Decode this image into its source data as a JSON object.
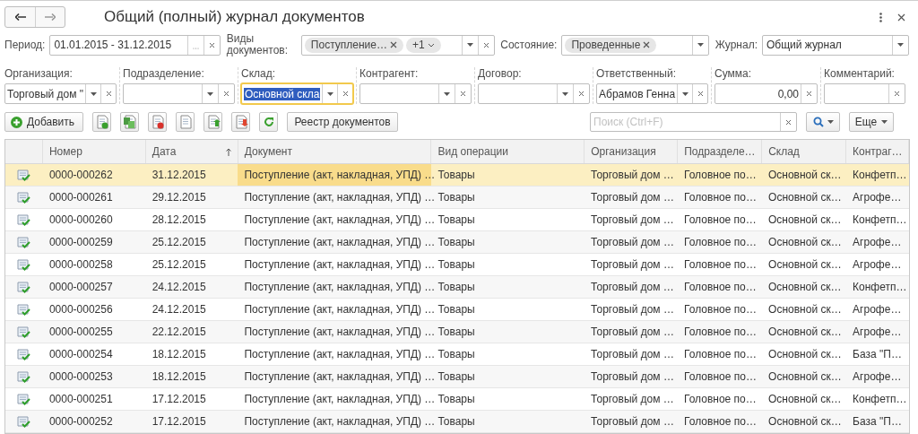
{
  "title": "Общий (полный) журнал документов",
  "filters": [
    {
      "kind": "period",
      "label": "Период:",
      "value": "01.01.2015 - 31.12.2015"
    },
    {
      "kind": "tags",
      "label": "Виды документов:",
      "tags": [
        "Поступление…"
      ],
      "more": "+1"
    },
    {
      "kind": "tags",
      "label": "Состояние:",
      "tags": [
        "Проведенные"
      ]
    },
    {
      "kind": "select",
      "label": "Журнал:",
      "value": "Общий журнал"
    }
  ],
  "fields": [
    {
      "kind": "select",
      "label": "Организация:",
      "value": "Торговый дом \"",
      "focused": false
    },
    {
      "kind": "select",
      "label": "Подразделение:",
      "focused": false
    },
    {
      "kind": "select",
      "label": "Склад:",
      "value": "Основной скла",
      "focused": true
    },
    {
      "kind": "select",
      "label": "Контрагент:",
      "focused": false
    },
    {
      "kind": "select",
      "label": "Договор:",
      "focused": false
    },
    {
      "kind": "select",
      "label": "Ответственный:",
      "value": "Абрамов Генна",
      "focused": false
    },
    {
      "kind": "number",
      "label": "Сумма:",
      "value": "0,00",
      "focused": false
    },
    {
      "kind": "text",
      "label": "Комментарий:",
      "focused": false
    }
  ],
  "toolbar": {
    "add": "Добавить",
    "registry": "Реестр документов",
    "search_placeholder": "Поиск (Ctrl+F)",
    "more": "Еще"
  },
  "columns": [
    {
      "label": "Номер",
      "sorted": false
    },
    {
      "label": "Дата",
      "sorted": true
    },
    {
      "label": "Документ",
      "sorted": false
    },
    {
      "label": "Вид операции",
      "sorted": false
    },
    {
      "label": "Организация",
      "sorted": false
    },
    {
      "label": "Подразделе…",
      "sorted": false
    },
    {
      "label": "Склад",
      "sorted": false
    },
    {
      "label": "Контраг…",
      "sorted": false
    }
  ],
  "rows": [
    {
      "selected": true,
      "cells": [
        "0000-000262",
        "31.12.2015",
        "Поступление (акт, накладная, УПД) …",
        "Товары",
        "Торговый дом …",
        "Головное по…",
        "Основной ск…",
        "Конфетп…"
      ]
    },
    {
      "selected": false,
      "cells": [
        "0000-000261",
        "29.12.2015",
        "Поступление (акт, накладная, УПД) …",
        "Товары",
        "Торговый дом …",
        "Головное по…",
        "Основной ск…",
        "Агрофе…"
      ]
    },
    {
      "selected": false,
      "cells": [
        "0000-000260",
        "28.12.2015",
        "Поступление (акт, накладная, УПД) …",
        "Товары",
        "Торговый дом …",
        "Головное по…",
        "Основной ск…",
        "Конфетп…"
      ]
    },
    {
      "selected": false,
      "cells": [
        "0000-000259",
        "25.12.2015",
        "Поступление (акт, накладная, УПД) …",
        "Товары",
        "Торговый дом …",
        "Головное по…",
        "Основной ск…",
        "Агрофе…"
      ]
    },
    {
      "selected": false,
      "cells": [
        "0000-000258",
        "25.12.2015",
        "Поступление (акт, накладная, УПД) …",
        "Товары",
        "Торговый дом …",
        "Головное по…",
        "Основной ск…",
        "Агрофе…"
      ]
    },
    {
      "selected": false,
      "cells": [
        "0000-000257",
        "24.12.2015",
        "Поступление (акт, накладная, УПД) …",
        "Товары",
        "Торговый дом …",
        "Головное по…",
        "Основной ск…",
        "Конфетп…"
      ]
    },
    {
      "selected": false,
      "cells": [
        "0000-000256",
        "24.12.2015",
        "Поступление (акт, накладная, УПД) …",
        "Товары",
        "Торговый дом …",
        "Головное по…",
        "Основной ск…",
        "Агрофе…"
      ]
    },
    {
      "selected": false,
      "cells": [
        "0000-000255",
        "22.12.2015",
        "Поступление (акт, накладная, УПД) …",
        "Товары",
        "Торговый дом …",
        "Головное по…",
        "Основной ск…",
        "Агрофе…"
      ]
    },
    {
      "selected": false,
      "cells": [
        "0000-000254",
        "18.12.2015",
        "Поступление (акт, накладная, УПД) …",
        "Товары",
        "Торговый дом …",
        "Головное по…",
        "Основной ск…",
        "База \"П…"
      ]
    },
    {
      "selected": false,
      "cells": [
        "0000-000253",
        "18.12.2015",
        "Поступление (акт, накладная, УПД) …",
        "Товары",
        "Торговый дом …",
        "Головное по…",
        "Основной ск…",
        "Агрофе…"
      ]
    },
    {
      "selected": false,
      "cells": [
        "0000-000251",
        "17.12.2015",
        "Поступление (акт, накладная, УПД) …",
        "Товары",
        "Торговый дом …",
        "Головное по…",
        "Основной ск…",
        "Конфетп…"
      ]
    },
    {
      "selected": false,
      "cells": [
        "0000-000252",
        "17.12.2015",
        "Поступление (акт, накладная, УПД) …",
        "Товары",
        "Торговый дом …",
        "Головное по…",
        "Основной ск…",
        "База \"П…"
      ]
    }
  ]
}
